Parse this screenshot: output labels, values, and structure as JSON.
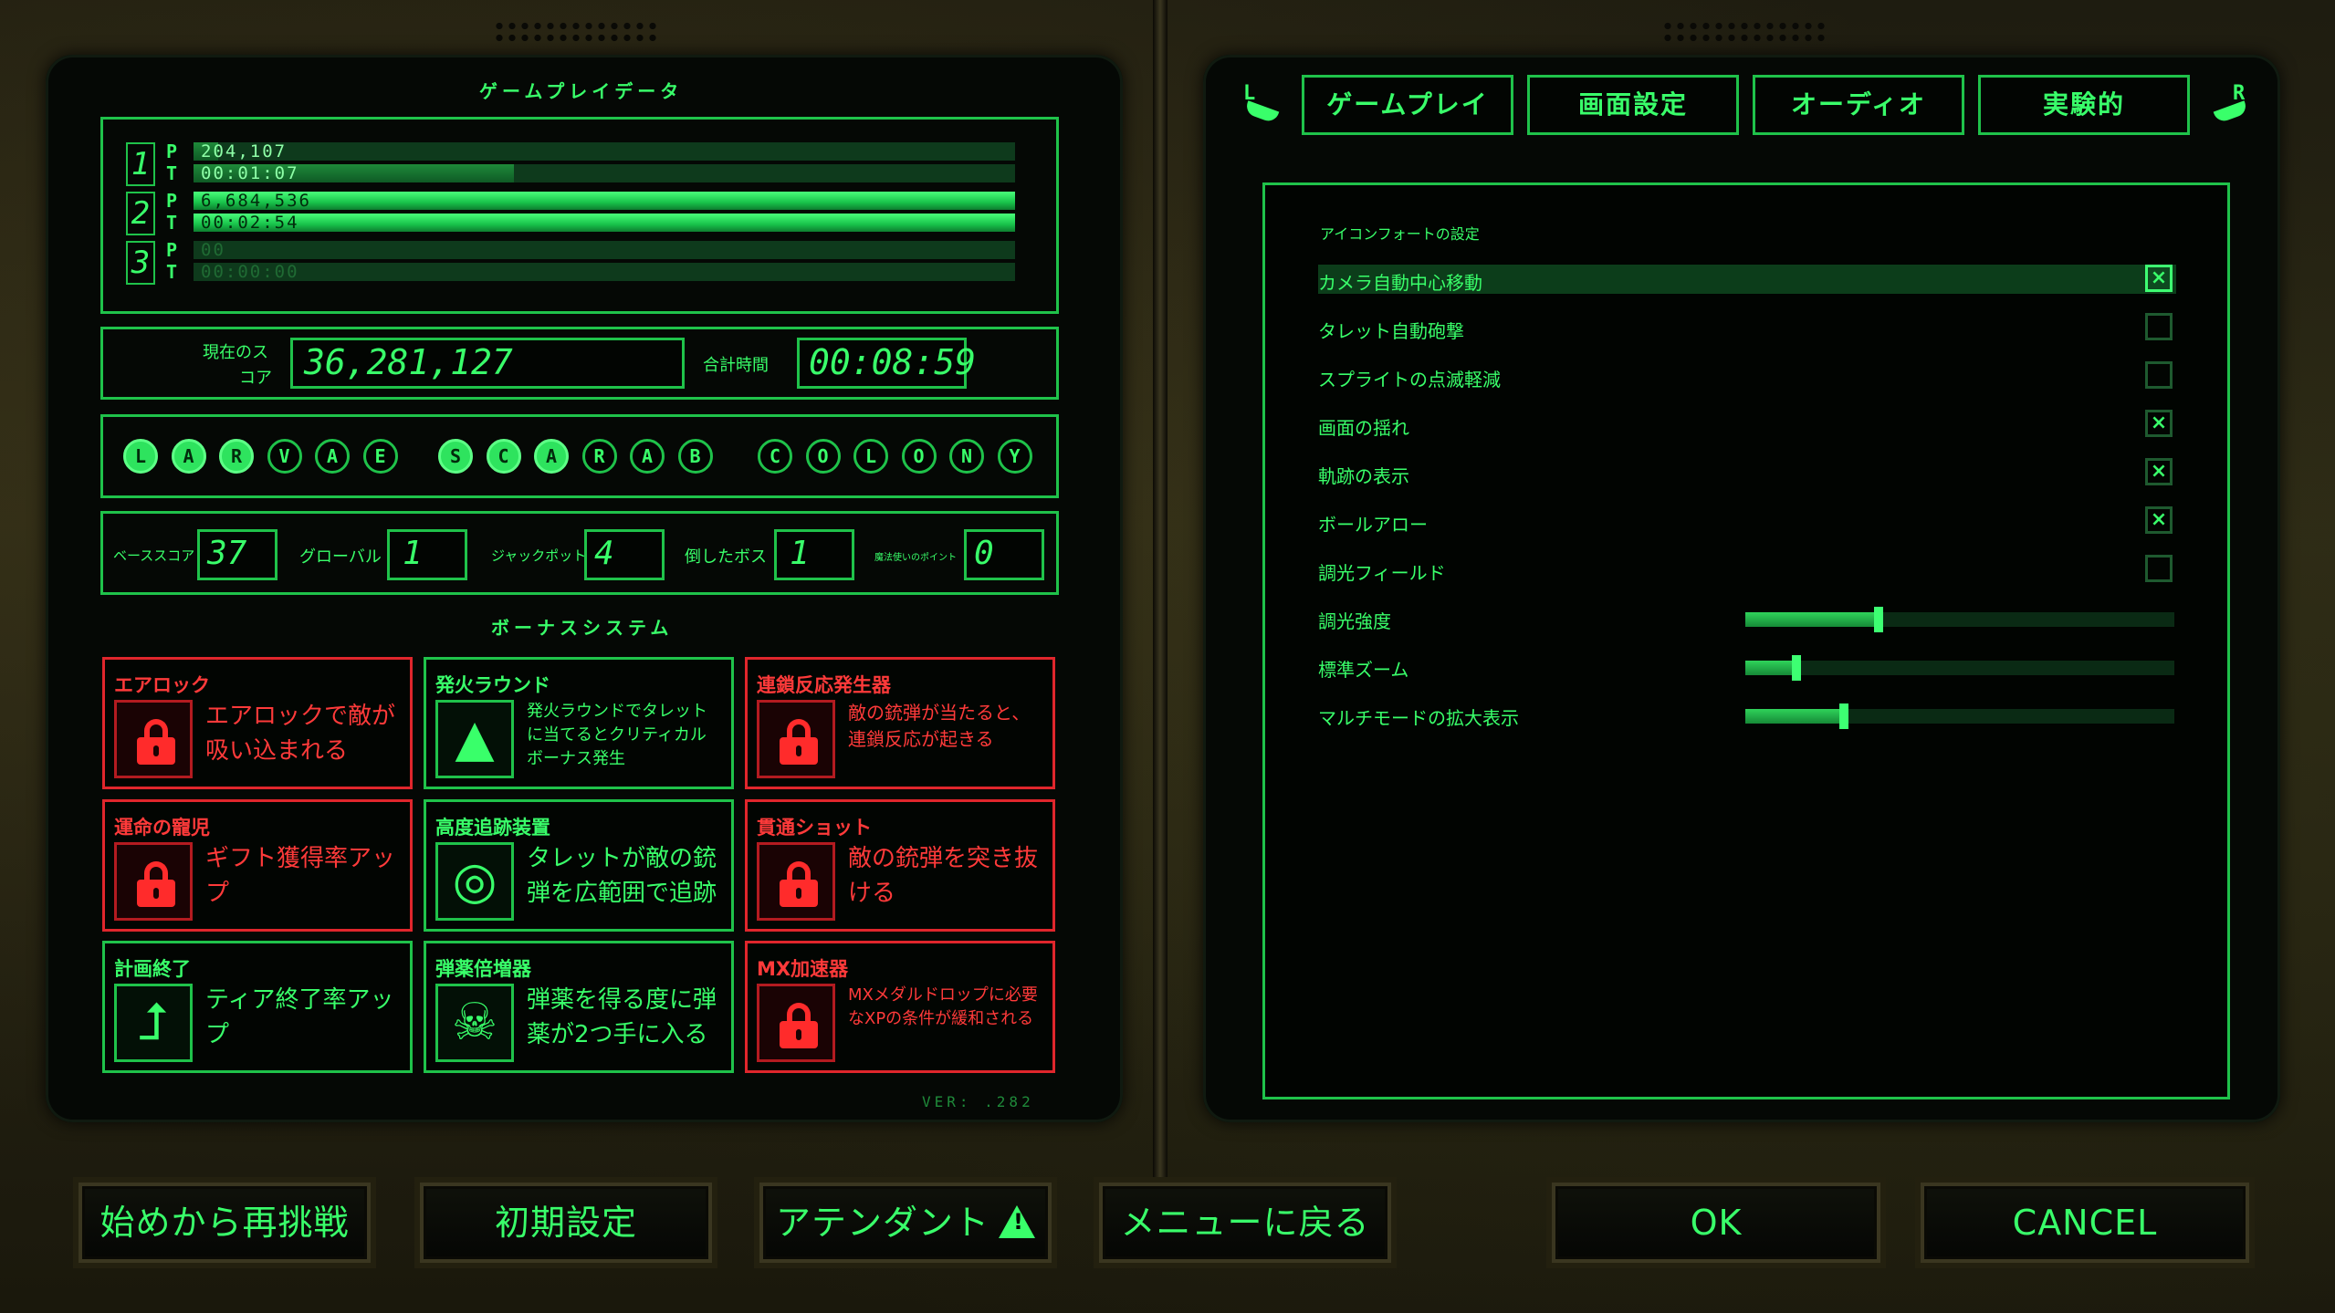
{
  "left_panel": {
    "gameplay_data_title": "ゲームプレイデータ",
    "profiles": [
      {
        "num": "1",
        "p_label": "P",
        "t_label": "T",
        "points": "204,107",
        "time": "00:01:07",
        "points_fill": 0.03,
        "time_fill": 0.39,
        "dim": false
      },
      {
        "num": "2",
        "p_label": "P",
        "t_label": "T",
        "points": "6,684,536",
        "time": "00:02:54",
        "points_fill": 1.0,
        "time_fill": 1.0,
        "dim": false
      },
      {
        "num": "3",
        "p_label": "P",
        "t_label": "T",
        "points": "00",
        "time": "00:00:00",
        "points_fill": 0,
        "time_fill": 0,
        "dim": true
      }
    ],
    "current_score_label_1": "現在のス",
    "current_score_label_2": "コア",
    "current_score": "36,281,127",
    "total_time_label": "合計時間",
    "total_time": "00:08:59",
    "words": [
      {
        "letters": [
          "L",
          "A",
          "R",
          "V",
          "A",
          "E"
        ],
        "lit": [
          true,
          true,
          true,
          false,
          false,
          false
        ]
      },
      {
        "letters": [
          "S",
          "C",
          "A",
          "R",
          "A",
          "B"
        ],
        "lit": [
          true,
          true,
          true,
          false,
          false,
          false
        ]
      },
      {
        "letters": [
          "C",
          "O",
          "L",
          "O",
          "N",
          "Y"
        ],
        "lit": [
          false,
          false,
          false,
          false,
          false,
          false
        ]
      }
    ],
    "stats": {
      "base_score_label": "ベーススコア",
      "base_score": "37",
      "global_label": "グローバル",
      "global": "1",
      "jackpot_label": "ジャックポット",
      "jackpot": "4",
      "bosses_label": "倒したボス",
      "bosses": "1",
      "mage_points_label": "魔法使いのポイント",
      "mage_points": "0"
    },
    "bonus_title": "ボーナスシステム",
    "bonuses": [
      {
        "title": "エアロック",
        "desc": "エアロックで敵が吸い込まれる",
        "locked": true,
        "icon": "lock-icon"
      },
      {
        "title": "発火ラウンド",
        "desc": "発火ラウンドでタレットに当てるとクリティカルボーナス発生",
        "locked": false,
        "icon": "fire-icon"
      },
      {
        "title": "連鎖反応発生器",
        "desc": "敵の銃弾が当たると、連鎖反応が起きる",
        "locked": true,
        "icon": "lock-icon"
      },
      {
        "title": "運命の寵児",
        "desc": "ギフト獲得率アップ",
        "locked": true,
        "icon": "lock-icon"
      },
      {
        "title": "高度追跡装置",
        "desc": "タレットが敵の銃弾を広範囲で追跡",
        "locked": false,
        "icon": "radar-icon"
      },
      {
        "title": "貫通ショット",
        "desc": "敵の銃弾を突き抜ける",
        "locked": true,
        "icon": "lock-icon"
      },
      {
        "title": "計画終了",
        "desc": "ティア終了率アップ",
        "locked": false,
        "icon": "exit-arrow-icon"
      },
      {
        "title": "弾薬倍増器",
        "desc": "弾薬を得る度に弾薬が2つ手に入る",
        "locked": false,
        "icon": "skulls-icon"
      },
      {
        "title": "MX加速器",
        "desc": "MXメダルドロップに必要なXPの条件が緩和される",
        "locked": true,
        "icon": "lock-icon"
      }
    ],
    "version": "VER: .282"
  },
  "right_panel": {
    "bumper_left": "L",
    "bumper_right": "R",
    "tabs": [
      "ゲームプレイ",
      "画面設定",
      "オーディオ",
      "実験的"
    ],
    "section_header": "アイコンフォートの設定",
    "checkbox_settings": [
      {
        "label": "カメラ自動中心移動",
        "checked": true,
        "selected": true
      },
      {
        "label": "タレット自動砲撃",
        "checked": false,
        "selected": false
      },
      {
        "label": "スプライトの点滅軽減",
        "checked": false,
        "selected": false
      },
      {
        "label": "画面の揺れ",
        "checked": true,
        "selected": false
      },
      {
        "label": "軌跡の表示",
        "checked": true,
        "selected": false
      },
      {
        "label": "ボールアロー",
        "checked": true,
        "selected": false
      },
      {
        "label": "調光フィールド",
        "checked": false,
        "selected": false
      }
    ],
    "slider_settings": [
      {
        "label": "調光強度",
        "value": 0.31
      },
      {
        "label": "標準ズーム",
        "value": 0.12
      },
      {
        "label": "マルチモードの拡大表示",
        "value": 0.23
      }
    ]
  },
  "bottom_buttons": {
    "restart": "始めから再挑戦",
    "defaults": "初期設定",
    "attendant": "アテンダント",
    "back_to_menu": "メニューに戻る",
    "ok": "OK",
    "cancel": "CANCEL"
  }
}
